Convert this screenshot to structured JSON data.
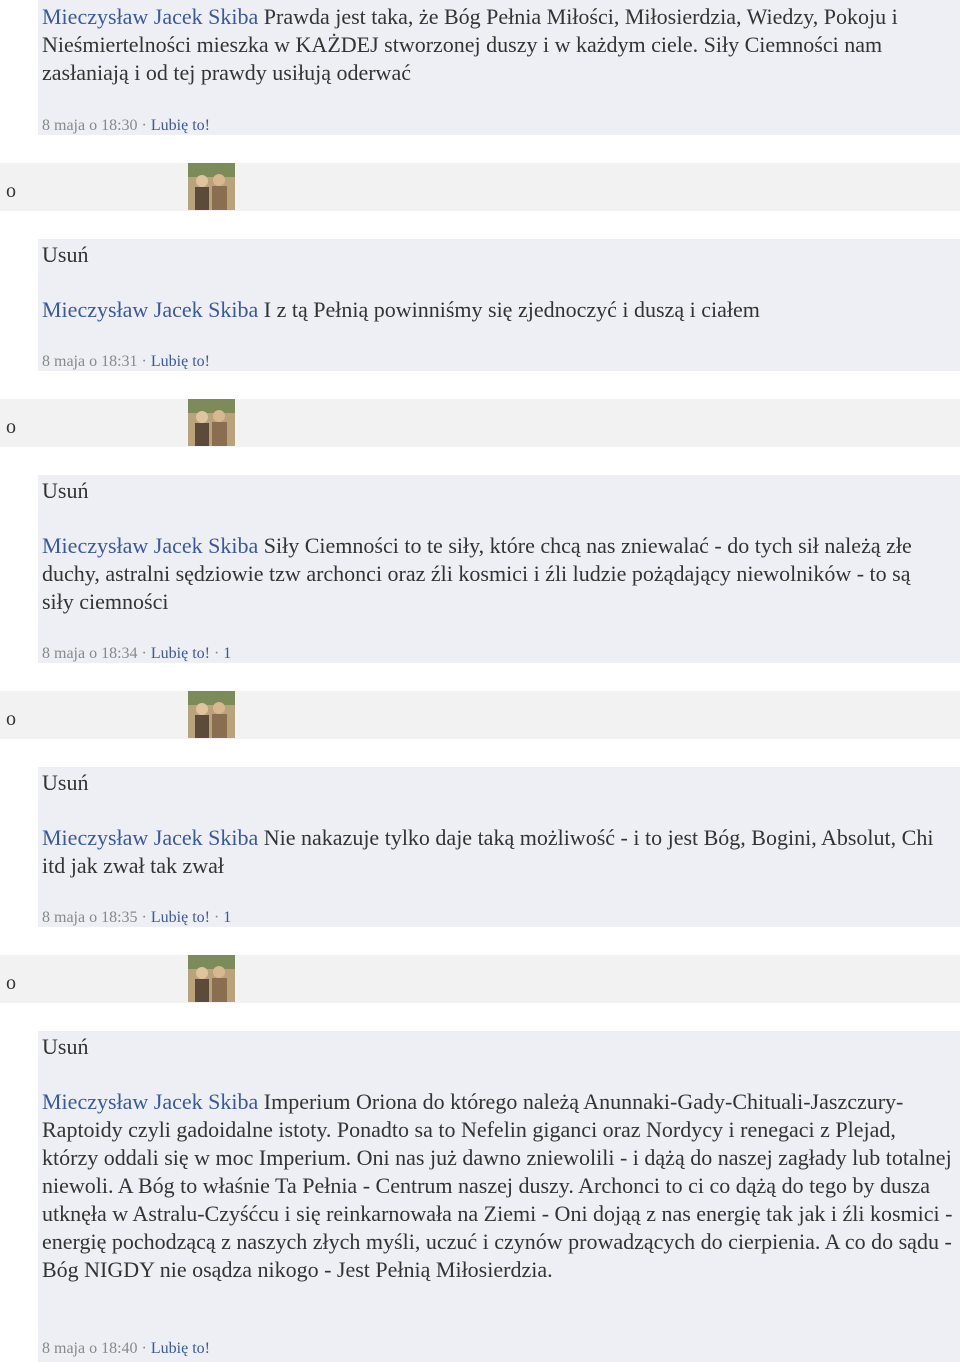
{
  "author": "Mieczysław Jacek Skiba",
  "like_label": "Lubię to!",
  "delete_label": "Usuń",
  "bullet": "o",
  "comments": [
    {
      "text": "Prawda jest taka, że Bóg Pełnia Miłości, Miłosierdzia, Wiedzy, Pokoju i Nieśmiertelności mieszka w KAŻDEJ stworzonej duszy i w każdym ciele. Siły Ciemności nam zasłaniają i od tej prawdy usiłują oderwać",
      "time": "8 maja o 18:30",
      "likes": ""
    },
    {
      "text": "I z tą Pełnią powinniśmy się zjednoczyć i duszą i ciałem",
      "time": "8 maja o 18:31",
      "likes": ""
    },
    {
      "text": "Siły Ciemności to te siły, które chcą nas zniewalać - do tych sił należą złe duchy, astralni sędziowie tzw archonci oraz źli kosmici i źli ludzie pożądający niewolników - to są siły ciemności",
      "time": "8 maja o 18:34",
      "likes": "1"
    },
    {
      "text": "Nie nakazuje tylko daje taką możliwość - i to jest Bóg, Bogini, Absolut, Chi itd jak zwał tak zwał",
      "time": "8 maja o 18:35",
      "likes": "1"
    },
    {
      "text": "Imperium Oriona do którego należą Anunnaki-Gady-Chituali-Jaszczury-Raptoidy czyli gadoidalne istoty. Ponadto sa to Nefelin giganci oraz Nordycy i renegaci z Plejad, którzy oddali się w moc Imperium. Oni nas już dawno zniewolili - i dążą do naszej zagłady lub totalnej niewoli. A Bóg to właśnie Ta Pełnia - Centrum naszej duszy. Archonci to ci co dążą do tego by dusza utknęła w Astralu-Czyśćcu i się reinkarnowała na Ziemi - Oni dojąą z nas energię tak jak i źli kosmici - energię pochodzącą z naszych złych myśli, uczuć i czynów prowadzących do cierpienia. A co do sądu - Bóg NIGDY nie osądza nikogo - Jest Pełnią Miłosierdzia.",
      "time": "8 maja o 18:40",
      "likes": ""
    }
  ]
}
